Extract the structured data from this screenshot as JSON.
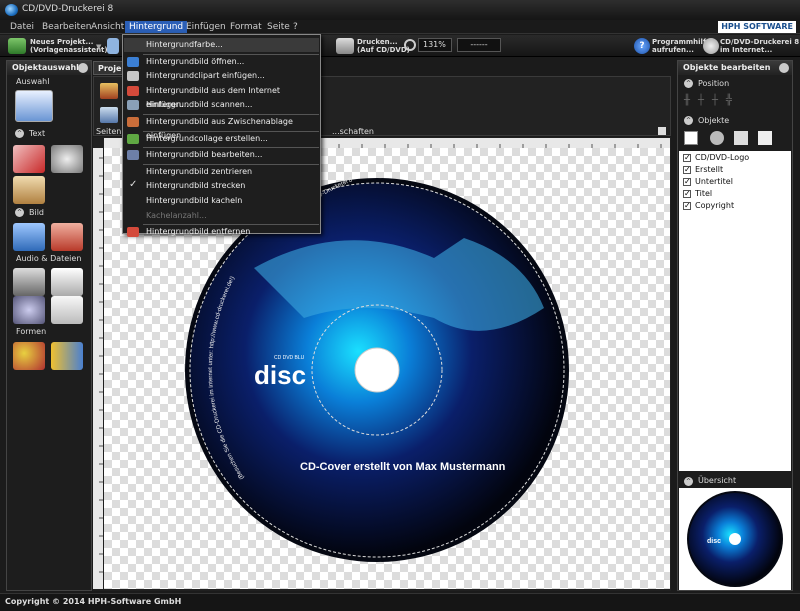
{
  "window": {
    "title": "CD/DVD-Druckerei 8"
  },
  "menubar": {
    "items": [
      "Datei",
      "Bearbeiten",
      "Ansicht",
      "Hintergrund",
      "Einfügen",
      "Format",
      "Seite",
      "?"
    ],
    "brand": "HPH SOFTWARE"
  },
  "toolbar": {
    "new_project": "Neues Projekt...",
    "new_project_sub": "(Vorlagenassistent)",
    "print": "Drucken...",
    "print_sub": "(Auf CD/DVD)",
    "zoom": "131%",
    "line": "------",
    "help": "Programmhilfe",
    "help_sub": "aufrufen...",
    "web": "CD/DVD-Druckerei 8",
    "web_sub": "im Internet..."
  },
  "left_panel": {
    "title": "Objektauswahl",
    "sections": {
      "selection": "Auswahl",
      "text": "Text",
      "image": "Bild",
      "audio": "Audio & Dateien",
      "shapes": "Formen"
    }
  },
  "center": {
    "tab": "Projekt...",
    "toolbar_left_label": "Seitenhi...",
    "toolbar_right_label": "...schaften"
  },
  "dropdown": {
    "items": [
      {
        "label": "Hintergrundfarbe...",
        "icon": "palette-icon",
        "color": "#d9a23a",
        "state": "normal"
      },
      {
        "label": "Hintergrundbild öffnen...",
        "icon": "open-image-icon",
        "color": "#3b7fd4",
        "state": "normal"
      },
      {
        "label": "Hintergrundclipart einfügen...",
        "icon": "clipart-icon",
        "color": "#c7c7c7",
        "state": "normal"
      },
      {
        "label": "Hintergrundbild aus dem Internet einfügen...",
        "icon": "internet-image-icon",
        "color": "#d44a3b",
        "state": "normal"
      },
      {
        "label": "Hintergrundbild scannen...",
        "icon": "scanner-icon",
        "color": "#8aa0b8",
        "state": "normal"
      },
      {
        "label": "Hintergrundbild aus Zwischenablage einfügen",
        "icon": "clipboard-icon",
        "color": "#c96d3a",
        "state": "normal"
      },
      {
        "label": "Hintergrundcollage erstellen...",
        "icon": "collage-icon",
        "color": "#5fa843",
        "state": "normal"
      },
      {
        "label": "Hintergrundbild bearbeiten...",
        "icon": "edit-image-icon",
        "color": "#6d7fa8",
        "state": "normal"
      },
      {
        "label": "Hintergrundbild zentrieren",
        "icon": "",
        "color": "",
        "state": "normal"
      },
      {
        "label": "Hintergrundbild strecken",
        "icon": "checkmark-icon",
        "color": "",
        "state": "checked"
      },
      {
        "label": "Hintergrundbild kacheln",
        "icon": "",
        "color": "",
        "state": "normal"
      },
      {
        "label": "Kachelanzahl...",
        "icon": "",
        "color": "",
        "state": "disabled"
      },
      {
        "label": "Hintergrundbild entfernen",
        "icon": "remove-image-icon",
        "color": "#d44a3b",
        "state": "normal"
      }
    ]
  },
  "disc": {
    "logo": "disc",
    "logo_small": "CD DVD BLU",
    "title": "CD-Cover erstellt von Max Mustermann",
    "curved_logo": "CD/DVD-Druckerei 8",
    "curved_copy": "(Besuchen Sie die CD-Druckerei im Internet unter: http://www.cd-druckerei.de!)",
    "curved_credit": "Erstellt mit der CD/DVD-Druckerei 8, © HPH-Software GmbH"
  },
  "right_panel": {
    "title": "Objekte bearbeiten",
    "position_label": "Position",
    "objects_label": "Objekte",
    "objects": [
      "CD/DVD-Logo",
      "Erstellt",
      "Untertitel",
      "Titel",
      "Copyright"
    ],
    "overview_label": "Übersicht"
  },
  "status": {
    "text": "Copyright © 2014 HPH-Software GmbH"
  },
  "ruler": {
    "h_ticks": [
      "5",
      "10",
      "15",
      "20",
      "25",
      "30",
      "35",
      "40",
      "45",
      "50",
      "55",
      "60",
      "65",
      "70",
      "75",
      "80",
      "85",
      "90",
      "95",
      "100",
      "105",
      "110",
      "115",
      "120"
    ],
    "v_ticks": [
      "0",
      "5",
      "10",
      "15",
      "20",
      "25",
      "30",
      "35",
      "40",
      "45",
      "50",
      "55",
      "60",
      "65",
      "70",
      "75",
      "80",
      "85",
      "90",
      "95",
      "100",
      "105",
      "110",
      "115"
    ]
  }
}
